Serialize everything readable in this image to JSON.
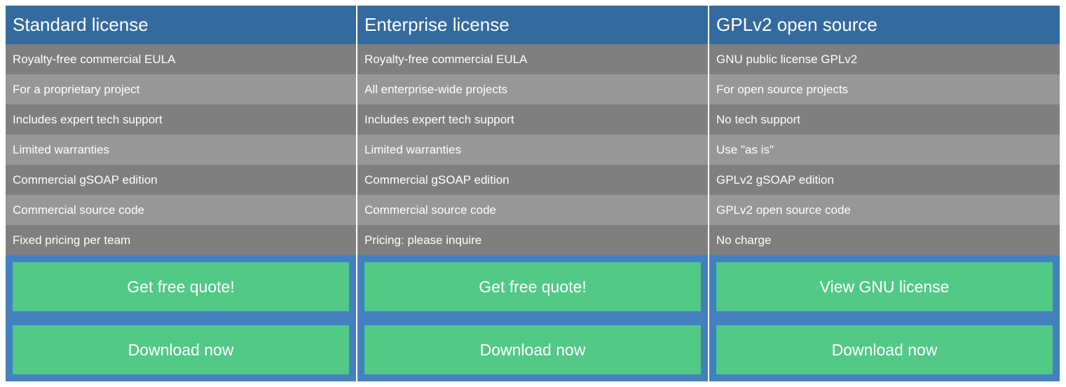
{
  "colors": {
    "header": "#356a9f",
    "row_dark": "#7f7f7f",
    "row_light": "#979797",
    "actions_bg": "#4380c0",
    "button": "#52c986"
  },
  "plans": [
    {
      "title": "Standard license",
      "features": [
        "Royalty-free commercial EULA",
        "For a proprietary project",
        "Includes expert tech support",
        "Limited warranties",
        "Commercial gSOAP edition",
        "Commercial source code",
        "Fixed pricing per team"
      ],
      "primary_button": "Get free quote!",
      "secondary_button": "Download now"
    },
    {
      "title": "Enterprise license",
      "features": [
        "Royalty-free commercial EULA",
        "All enterprise-wide projects",
        "Includes expert tech support",
        "Limited warranties",
        "Commercial gSOAP edition",
        "Commercial source code",
        "Pricing: please inquire"
      ],
      "primary_button": "Get free quote!",
      "secondary_button": "Download now"
    },
    {
      "title": "GPLv2 open source",
      "features": [
        "GNU public license GPLv2",
        "For open source projects",
        "No tech support",
        "Use \"as is\"",
        "GPLv2 gSOAP edition",
        "GPLv2 open source code",
        "No charge"
      ],
      "primary_button": "View GNU license",
      "secondary_button": "Download now"
    }
  ]
}
